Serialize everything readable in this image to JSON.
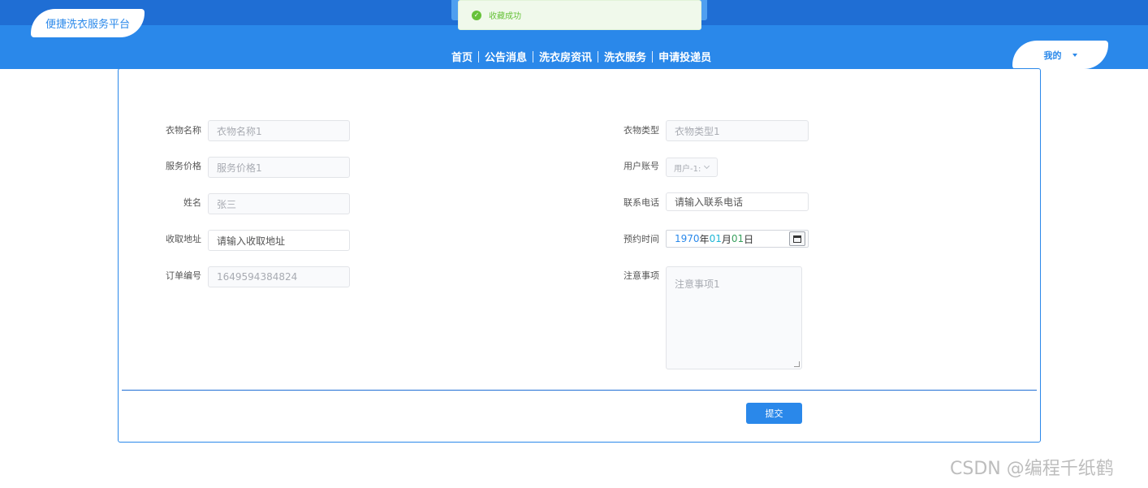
{
  "header": {
    "logo_text": "便捷洗衣服务平台",
    "toast_message": "收藏成功",
    "toast_icon": "check-circle-icon",
    "nav": [
      "首页",
      "公告消息",
      "洗衣房资讯",
      "洗衣服务",
      "申请投递员"
    ],
    "user_menu_label": "我的"
  },
  "form": {
    "left": [
      {
        "label": "衣物名称",
        "value": "衣物名称1"
      },
      {
        "label": "服务价格",
        "value": "服务价格1"
      },
      {
        "label": "姓名",
        "value": "张三"
      },
      {
        "label": "收取地址",
        "placeholder": "请输入收取地址"
      },
      {
        "label": "订单编号",
        "value": "1649594384824"
      }
    ],
    "right": [
      {
        "label": "衣物类型",
        "value": "衣物类型1"
      },
      {
        "label": "用户账号",
        "value": "用户-1:"
      },
      {
        "label": "联系电话",
        "placeholder": "请输入联系电话"
      },
      {
        "label": "预约时间",
        "year": "1970",
        "year_unit": "年",
        "month": "01",
        "month_unit": "月",
        "day": "01",
        "day_unit": "日"
      },
      {
        "label": "注意事项",
        "value": "注意事项1"
      }
    ],
    "submit_label": "提交"
  },
  "watermark": "CSDN @编程千纸鹤",
  "colors": {
    "primary": "#2a88ea",
    "dark_primary": "#1f6ed4",
    "success": "#67c23a"
  }
}
